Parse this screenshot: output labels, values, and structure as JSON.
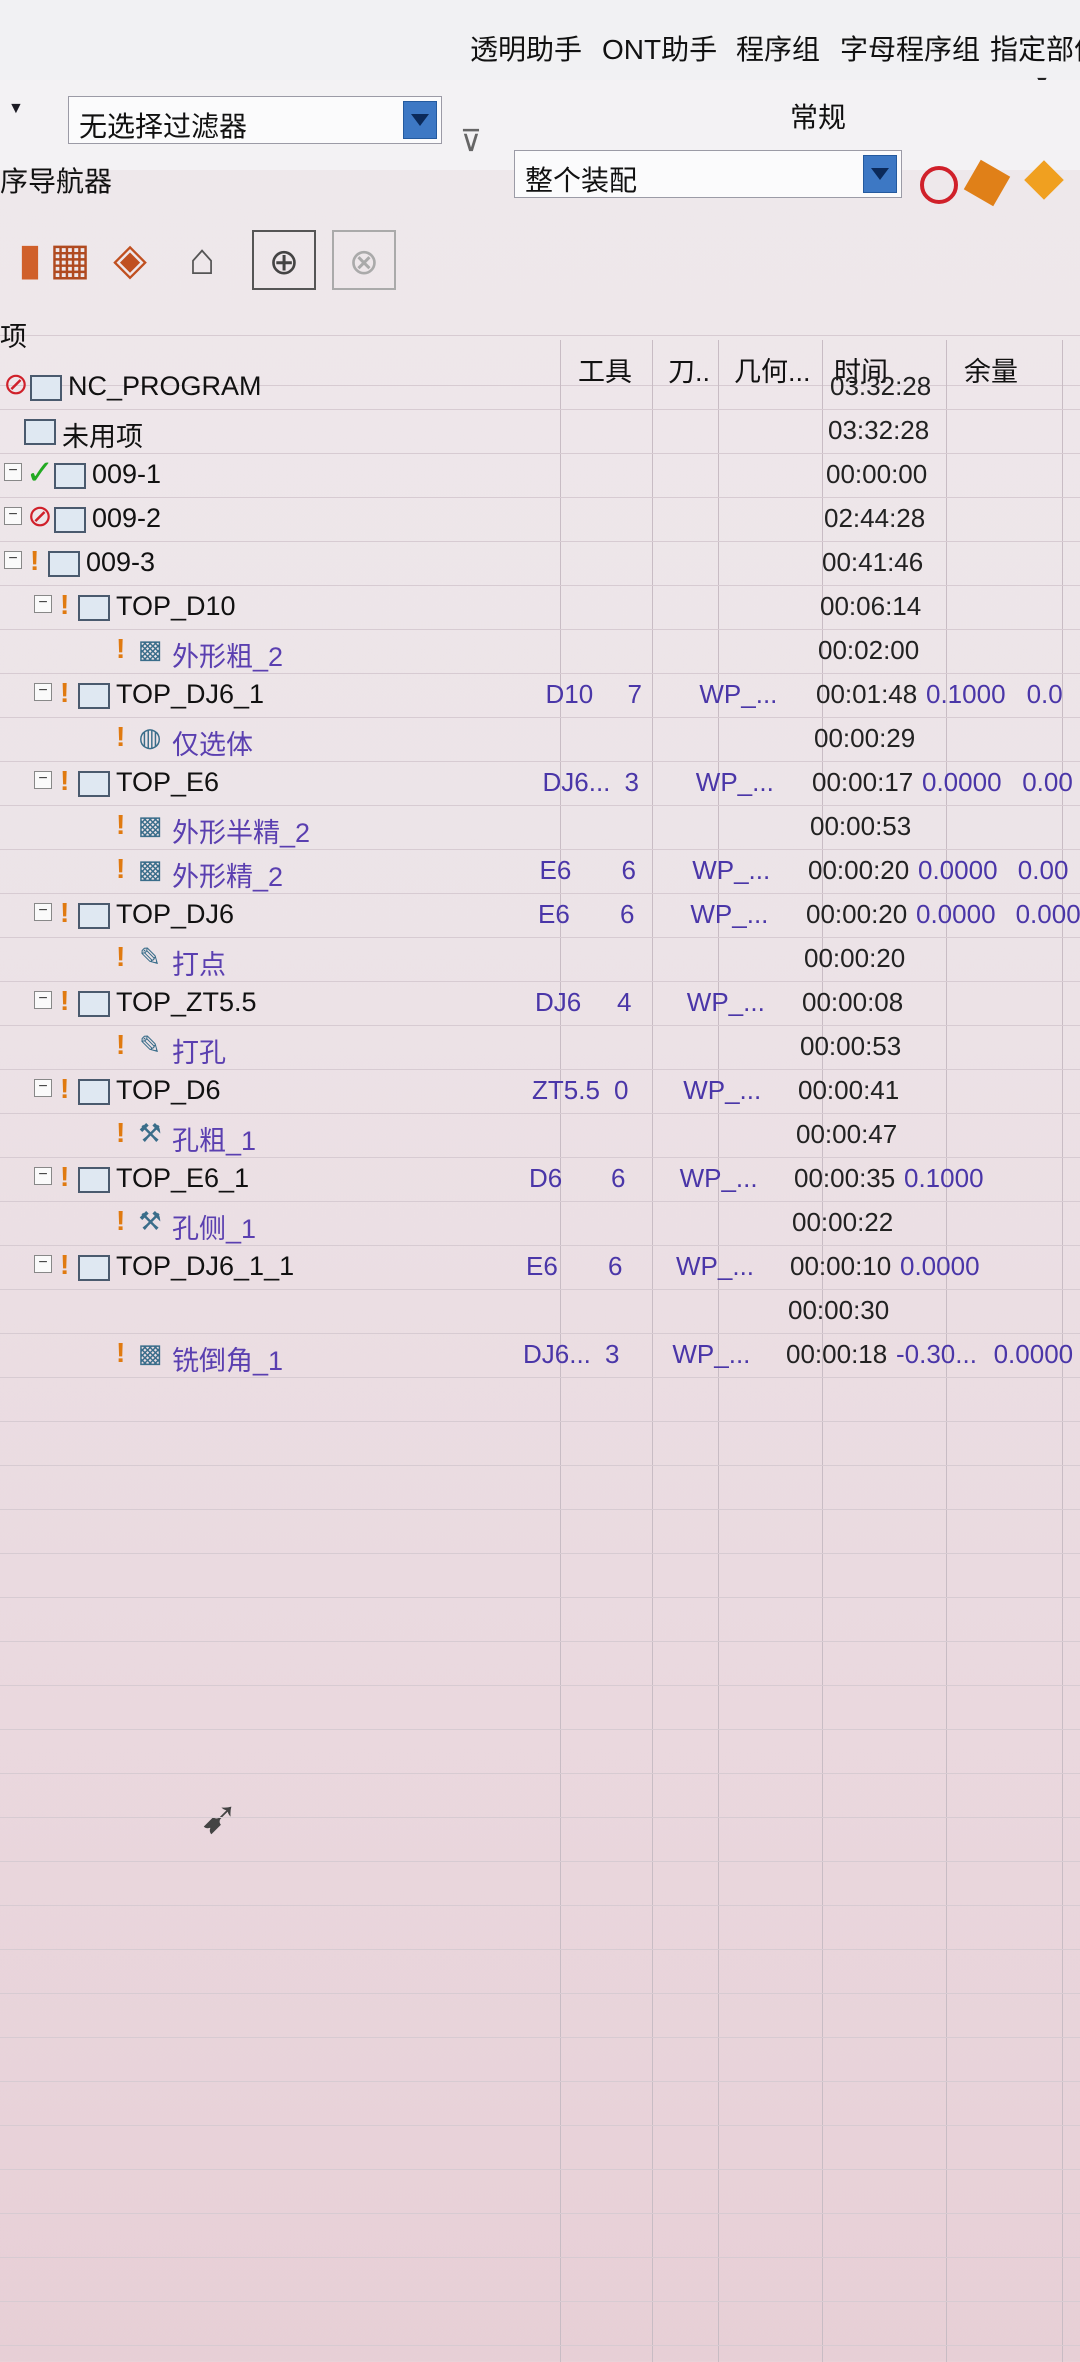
{
  "menu": {
    "items": [
      "透明助手",
      "ONT助手",
      "程序组",
      "字母程序组",
      "指定部件"
    ]
  },
  "filter": {
    "filter_value": "无选择过滤器",
    "scope_value": "整个装配",
    "section_label": "常规"
  },
  "navigator": {
    "title": "序导航器"
  },
  "columns": {
    "name": "项",
    "tool": "工具",
    "tool_no": "刀..",
    "geometry": "几何...",
    "time": "时间",
    "stock": "余量"
  },
  "rows": [
    {
      "name": "NC_PROGRAM",
      "tool": "",
      "tool_no": "",
      "geometry": "",
      "time": "03:32:28",
      "stock": "",
      "stock2": ""
    },
    {
      "name": "未用项",
      "tool": "",
      "tool_no": "",
      "geometry": "",
      "time": "03:32:28",
      "stock": "",
      "stock2": ""
    },
    {
      "name": "009-1",
      "tool": "",
      "tool_no": "",
      "geometry": "",
      "time": "00:00:00",
      "stock": "",
      "stock2": ""
    },
    {
      "name": "009-2",
      "tool": "",
      "tool_no": "",
      "geometry": "",
      "time": "02:44:28",
      "stock": "",
      "stock2": ""
    },
    {
      "name": "009-3",
      "tool": "",
      "tool_no": "",
      "geometry": "",
      "time": "00:41:46",
      "stock": "",
      "stock2": ""
    },
    {
      "name": "TOP_D10",
      "tool": "",
      "tool_no": "",
      "geometry": "",
      "time": "00:06:14",
      "stock": "",
      "stock2": ""
    },
    {
      "name": "外形粗_2",
      "tool": "",
      "tool_no": "",
      "geometry": "",
      "time": "00:02:00",
      "stock": "",
      "stock2": ""
    },
    {
      "name": "TOP_DJ6_1",
      "tool": "D10",
      "tool_no": "7",
      "geometry": "WP_...",
      "time": "00:01:48",
      "stock": "0.1000",
      "stock2": "0.0"
    },
    {
      "name": "仅选体",
      "tool": "",
      "tool_no": "",
      "geometry": "",
      "time": "00:00:29",
      "stock": "",
      "stock2": ""
    },
    {
      "name": "TOP_E6",
      "tool": "DJ6...",
      "tool_no": "3",
      "geometry": "WP_...",
      "time": "00:00:17",
      "stock": "0.0000",
      "stock2": "0.00"
    },
    {
      "name": "外形半精_2",
      "tool": "",
      "tool_no": "",
      "geometry": "",
      "time": "00:00:53",
      "stock": "",
      "stock2": ""
    },
    {
      "name": "外形精_2",
      "tool": "E6",
      "tool_no": "6",
      "geometry": "WP_...",
      "time": "00:00:20",
      "stock": "0.0000",
      "stock2": "0.00"
    },
    {
      "name": "TOP_DJ6",
      "tool": "E6",
      "tool_no": "6",
      "geometry": "WP_...",
      "time": "00:00:20",
      "stock": "0.0000",
      "stock2": "0.000"
    },
    {
      "name": "打点",
      "tool": "",
      "tool_no": "",
      "geometry": "",
      "time": "00:00:20",
      "stock": "",
      "stock2": ""
    },
    {
      "name": "TOP_ZT5.5",
      "tool": "DJ6",
      "tool_no": "4",
      "geometry": "WP_...",
      "time": "00:00:08",
      "stock": "",
      "stock2": ""
    },
    {
      "name": "打孔",
      "tool": "",
      "tool_no": "",
      "geometry": "",
      "time": "00:00:53",
      "stock": "",
      "stock2": ""
    },
    {
      "name": "TOP_D6",
      "tool": "ZT5.5",
      "tool_no": "0",
      "geometry": "WP_...",
      "time": "00:00:41",
      "stock": "",
      "stock2": ""
    },
    {
      "name": "孔粗_1",
      "tool": "",
      "tool_no": "",
      "geometry": "",
      "time": "00:00:47",
      "stock": "",
      "stock2": ""
    },
    {
      "name": "TOP_E6_1",
      "tool": "D6",
      "tool_no": "6",
      "geometry": "WP_...",
      "time": "00:00:35",
      "stock": "0.1000",
      "stock2": ""
    },
    {
      "name": "孔侧_1",
      "tool": "",
      "tool_no": "",
      "geometry": "",
      "time": "00:00:22",
      "stock": "",
      "stock2": ""
    },
    {
      "name": "TOP_DJ6_1_1",
      "tool": "E6",
      "tool_no": "6",
      "geometry": "WP_...",
      "time": "00:00:10",
      "stock": "0.0000",
      "stock2": ""
    },
    {
      "name": "",
      "tool": "",
      "tool_no": "",
      "geometry": "",
      "time": "00:00:30",
      "stock": "",
      "stock2": ""
    },
    {
      "name": "铣倒角_1",
      "tool": "DJ6...",
      "tool_no": "3",
      "geometry": "WP_...",
      "time": "00:00:18",
      "stock": "-0.30...",
      "stock2": "0.0000"
    }
  ],
  "colors": {
    "status_ok": "#22aa22",
    "status_error": "#d0202a",
    "status_warn": "#e07a10",
    "operation_text": "#5a3fb0",
    "dropdown_blue": "#3d78c4"
  }
}
